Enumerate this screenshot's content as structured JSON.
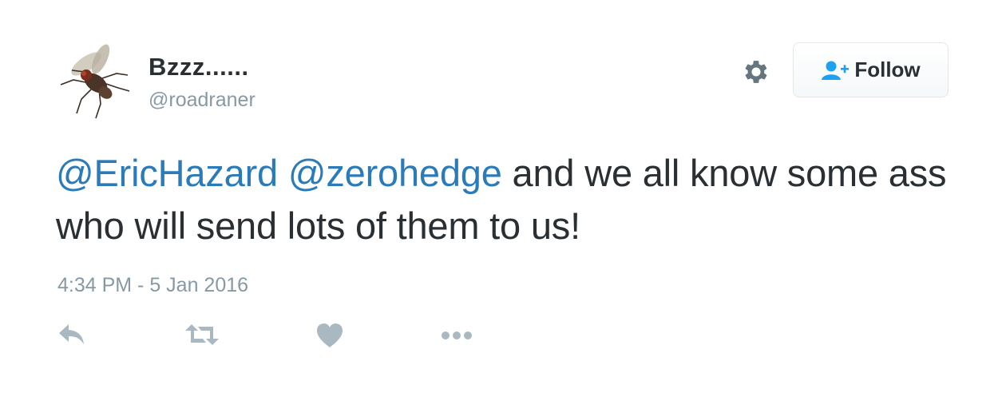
{
  "tweet": {
    "author": {
      "display_name": "Bzzz......",
      "handle": "@roadraner",
      "avatar_icon": "fly-avatar"
    },
    "follow_label": "Follow",
    "settings_icon": "gear-icon",
    "text": {
      "mention_1": "@EricHazard",
      "mention_2": "@zerohedge",
      "body": " and we all know some ass who will send lots of them to us!"
    },
    "timestamp": "4:34 PM - 5 Jan 2016",
    "actions": [
      "reply-icon",
      "retweet-icon",
      "like-icon",
      "more-icon"
    ]
  },
  "colors": {
    "text": "#292f33",
    "muted": "#8899a6",
    "link": "#2b7bb9",
    "follow_icon": "#1da1f2"
  }
}
